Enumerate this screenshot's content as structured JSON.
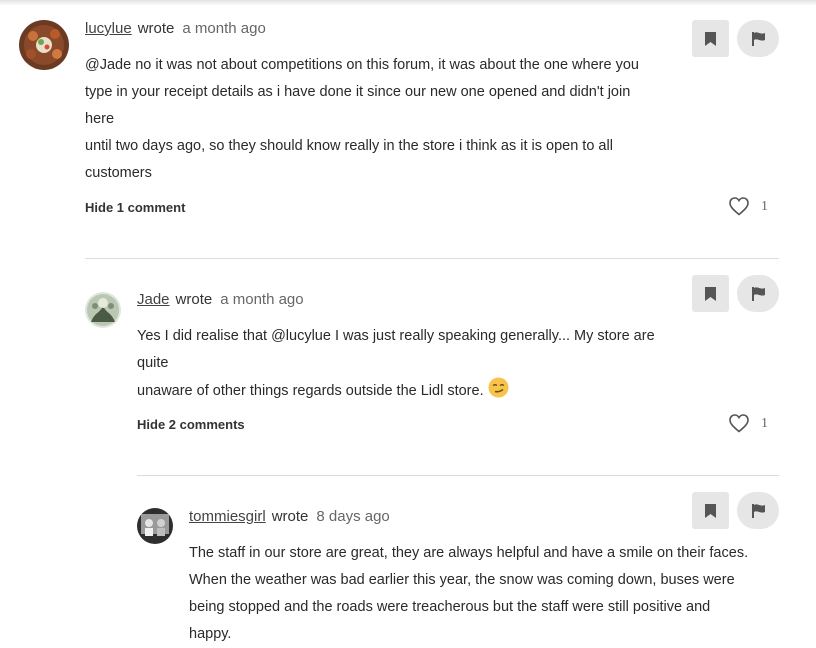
{
  "comments": [
    {
      "username": "lucylue",
      "wrote": "wrote",
      "time": "a month ago",
      "lines": [
        "@Jade no it was not about competitions on this forum, it was about the one where you",
        "type in your receipt details as i have done it since our new one opened and didn't join here",
        "until two days ago, so they should know really in the store i think as it is open to all",
        "customers"
      ],
      "toggle_label": "Hide 1 comment",
      "likes": "1"
    },
    {
      "username": "Jade",
      "wrote": "wrote",
      "time": "a month ago",
      "lines": [
        "Yes I did realise that @lucylue I was just really speaking generally... My store are quite",
        "unaware of other things regards outside the Lidl store."
      ],
      "emoji": "smirk-emoji",
      "toggle_label": "Hide 2 comments",
      "likes": "1"
    },
    {
      "username": "tommiesgirl",
      "wrote": "wrote",
      "time": "8 days ago",
      "lines": [
        "The staff in our store are great, they are always helpful and have a smile on their faces.",
        "When the weather was bad earlier this year, the snow was coming down, buses were",
        "being stopped and the roads were treacherous but the staff were still positive and happy."
      ]
    }
  ],
  "icons": {
    "bookmark": "bookmark-icon",
    "flag": "flag-icon",
    "like": "heart-icon"
  },
  "colors": {
    "button_bg": "#e6e6e6",
    "icon": "#555555",
    "divider": "#dcdcdc"
  }
}
